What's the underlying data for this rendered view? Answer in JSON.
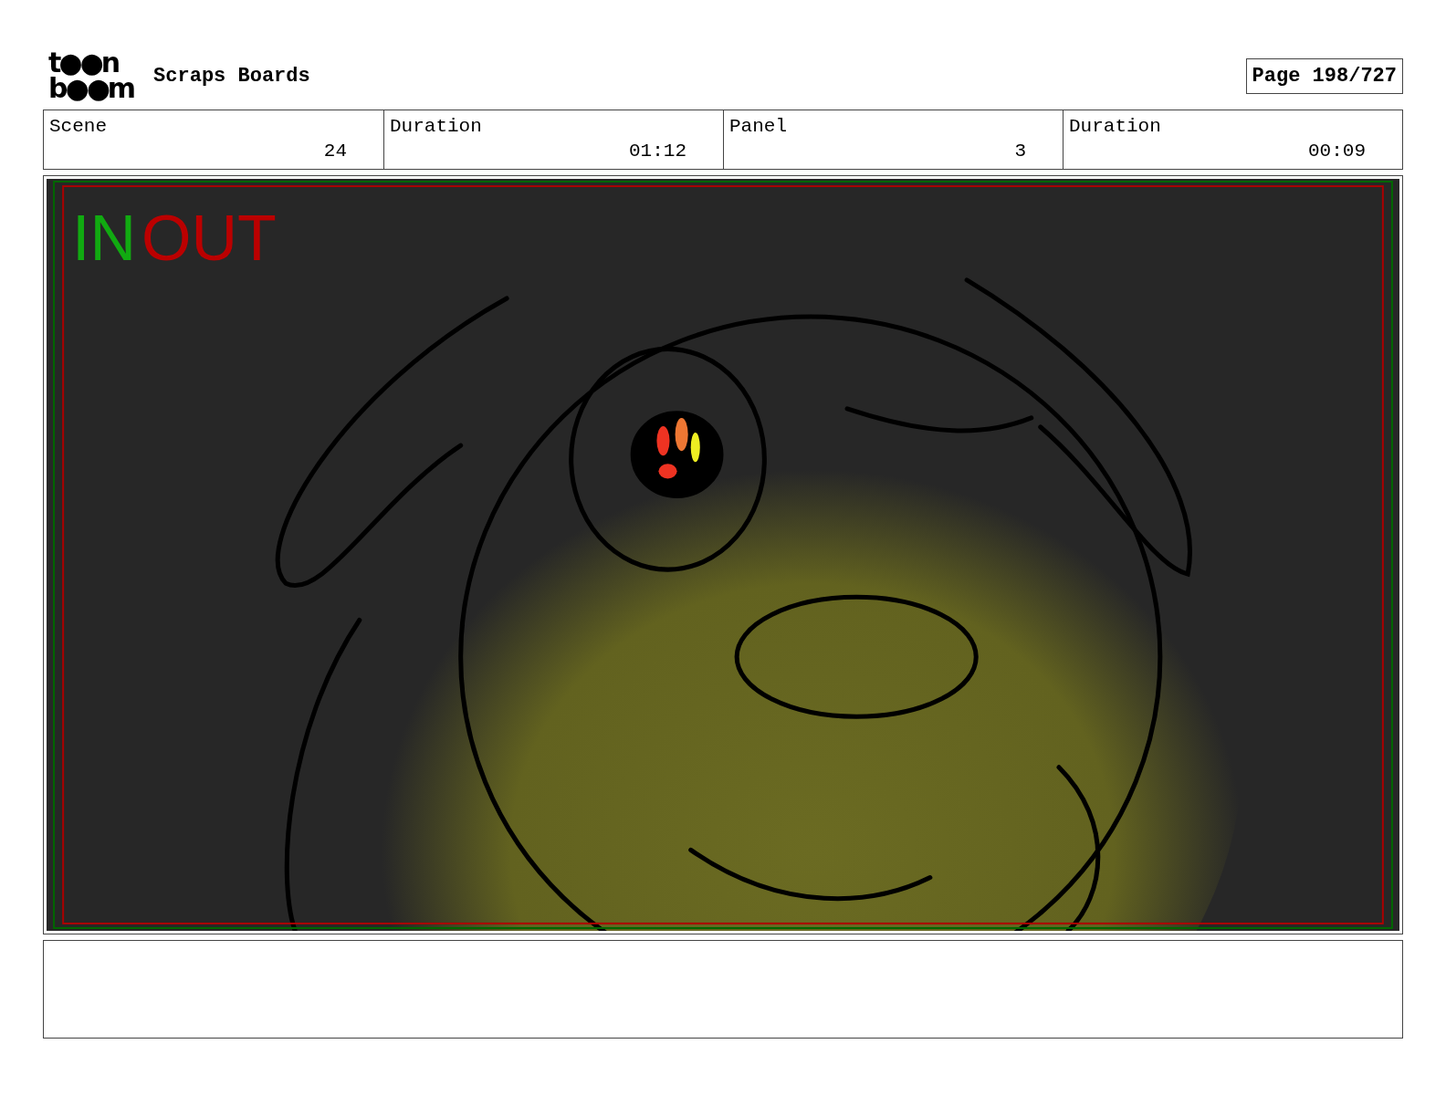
{
  "header": {
    "logo_top": "t●●n",
    "logo_bottom": "b●●m",
    "title": "Scraps Boards",
    "page": "Page 198/727"
  },
  "info": [
    {
      "label": "Scene",
      "value": "24"
    },
    {
      "label": "Duration",
      "value": "01:12"
    },
    {
      "label": "Panel",
      "value": "3"
    },
    {
      "label": "Duration",
      "value": "00:09"
    }
  ],
  "panel": {
    "in_marker": "IN",
    "out_marker": "OUT"
  }
}
